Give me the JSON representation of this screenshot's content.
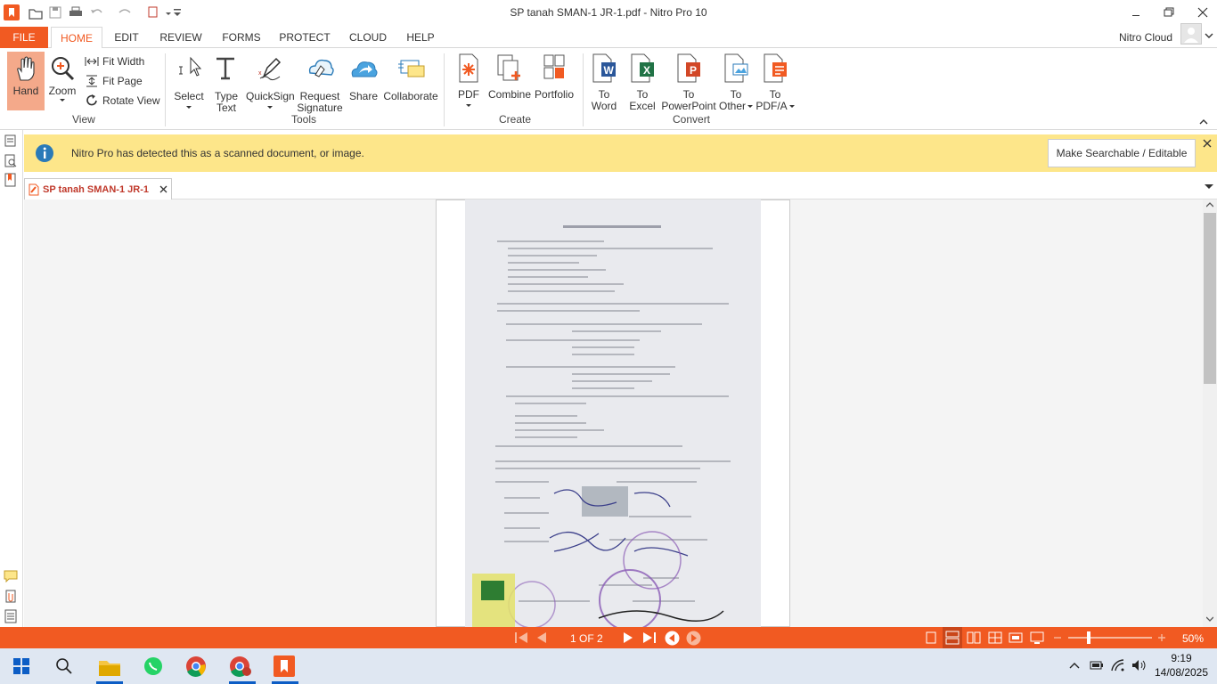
{
  "window": {
    "title": "SP tanah SMAN-1 JR-1.pdf - Nitro Pro 10"
  },
  "menu_tabs": [
    "FILE",
    "HOME",
    "EDIT",
    "REVIEW",
    "FORMS",
    "PROTECT",
    "CLOUD",
    "HELP"
  ],
  "account": {
    "label": "Nitro Cloud"
  },
  "ribbon": {
    "view": {
      "hand": "Hand",
      "zoom": "Zoom",
      "fit_width": "Fit Width",
      "fit_page": "Fit Page",
      "rotate_view": "Rotate View",
      "group": "View"
    },
    "tools": {
      "select": "Select",
      "type_text_1": "Type",
      "type_text_2": "Text",
      "quicksign": "QuickSign",
      "request_sig_1": "Request",
      "request_sig_2": "Signature",
      "share": "Share",
      "collaborate": "Collaborate",
      "group": "Tools"
    },
    "create": {
      "pdf": "PDF",
      "combine": "Combine",
      "portfolio": "Portfolio",
      "group": "Create"
    },
    "convert": {
      "to1": "To",
      "word": "Word",
      "excel": "Excel",
      "powerpoint": "PowerPoint",
      "other": "Other",
      "pdfa": "PDF/A",
      "group": "Convert"
    }
  },
  "notification": {
    "message": "Nitro Pro has detected this as a scanned document, or image.",
    "button": "Make Searchable / Editable"
  },
  "doc_tab": {
    "name": "SP tanah SMAN-1 JR-1"
  },
  "status": {
    "page": "1 OF 2",
    "zoom": "50%"
  },
  "taskbar": {
    "time": "9:19",
    "date": "14/08/2025"
  },
  "colors": {
    "accent": "#f15a22",
    "notification_bg": "#fde68a",
    "taskbar_bg": "#dfe7f2"
  }
}
